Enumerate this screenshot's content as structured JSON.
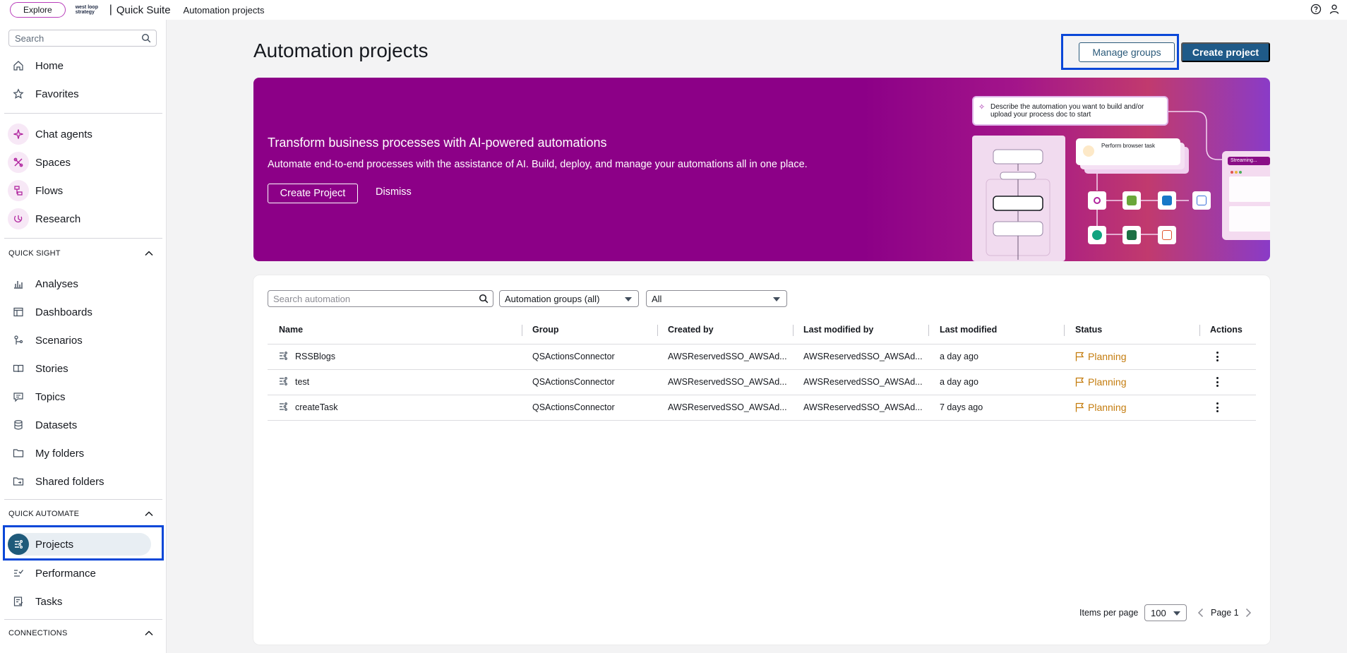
{
  "topbar": {
    "explore_label": "Explore",
    "brand_logo": "west loop strategy",
    "brand_name": "Quick Suite",
    "breadcrumb": "Automation projects"
  },
  "sidebar": {
    "search_placeholder": "Search",
    "top_items": [
      {
        "label": "Home",
        "icon": "home-icon"
      },
      {
        "label": "Favorites",
        "icon": "star-icon"
      }
    ],
    "ai_items": [
      {
        "label": "Chat agents",
        "icon": "sparkle-icon"
      },
      {
        "label": "Spaces",
        "icon": "spaces-icon"
      },
      {
        "label": "Flows",
        "icon": "flows-icon"
      },
      {
        "label": "Research",
        "icon": "research-icon"
      }
    ],
    "quick_sight": {
      "title": "QUICK SIGHT",
      "items": [
        {
          "label": "Analyses"
        },
        {
          "label": "Dashboards"
        },
        {
          "label": "Scenarios"
        },
        {
          "label": "Stories"
        },
        {
          "label": "Topics"
        },
        {
          "label": "Datasets"
        },
        {
          "label": "My folders"
        },
        {
          "label": "Shared folders"
        }
      ]
    },
    "quick_automate": {
      "title": "QUICK AUTOMATE",
      "items": [
        {
          "label": "Projects",
          "active": true
        },
        {
          "label": "Performance"
        },
        {
          "label": "Tasks"
        }
      ]
    },
    "connections": {
      "title": "CONNECTIONS"
    }
  },
  "main": {
    "title": "Automation projects",
    "manage_groups_label": "Manage groups",
    "create_project_label": "Create project"
  },
  "banner": {
    "title": "Transform business processes with AI-powered automations",
    "subtitle": "Automate end-to-end processes with the assistance of AI. Build, deploy, and manage your automations all in one place.",
    "create_label": "Create Project",
    "dismiss_label": "Dismiss",
    "illustration": {
      "prompt_text": "Describe the automation you want to build and/or upload your process doc to start",
      "card_text": "Perform browser task",
      "window_tag": "Streaming..."
    }
  },
  "table": {
    "search_placeholder": "Search automation",
    "group_filter": "Automation groups (all)",
    "status_filter": "All",
    "columns": [
      "Name",
      "Group",
      "Created by",
      "Last modified by",
      "Last modified",
      "Status",
      "Actions"
    ],
    "rows": [
      {
        "name": "RSSBlogs",
        "group": "QSActionsConnector",
        "created_by": "AWSReservedSSO_AWSAd...",
        "modified_by": "AWSReservedSSO_AWSAd...",
        "modified": "a day ago",
        "status": "Planning"
      },
      {
        "name": "test",
        "group": "QSActionsConnector",
        "created_by": "AWSReservedSSO_AWSAd...",
        "modified_by": "AWSReservedSSO_AWSAd...",
        "modified": "a day ago",
        "status": "Planning"
      },
      {
        "name": "createTask",
        "group": "QSActionsConnector",
        "created_by": "AWSReservedSSO_AWSAd...",
        "modified_by": "AWSReservedSSO_AWSAd...",
        "modified": "7 days ago",
        "status": "Planning"
      }
    ],
    "pagination": {
      "items_per_page_label": "Items per page",
      "items_per_page": "100",
      "page_label": "Page 1"
    }
  },
  "colors": {
    "accent": "#1f5a88",
    "banner": "#8c0087",
    "status_planning": "#c47c0e",
    "highlight": "#0a47d8"
  }
}
